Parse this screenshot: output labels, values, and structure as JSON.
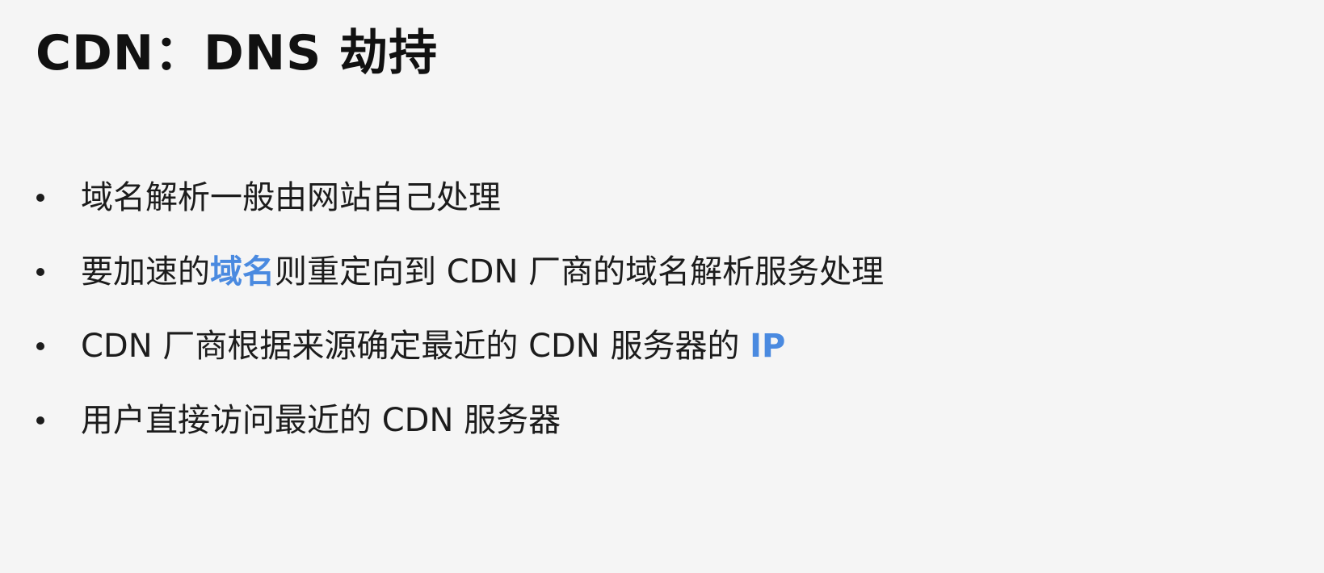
{
  "slide": {
    "title": "CDN：DNS 劫持",
    "bullets": [
      {
        "segments": [
          {
            "text": "域名解析一般由网站自己处理",
            "highlight": false
          }
        ]
      },
      {
        "segments": [
          {
            "text": "要加速的",
            "highlight": false
          },
          {
            "text": "域名",
            "highlight": true
          },
          {
            "text": "则重定向到 CDN 厂商的域名解析服务处理",
            "highlight": false
          }
        ]
      },
      {
        "segments": [
          {
            "text": "CDN 厂商根据来源确定最近的 CDN 服务器的 ",
            "highlight": false
          },
          {
            "text": "IP",
            "highlight": true
          }
        ]
      },
      {
        "segments": [
          {
            "text": "用户直接访问最近的 CDN 服务器",
            "highlight": false
          }
        ]
      }
    ]
  },
  "colors": {
    "background": "#f5f5f5",
    "text": "#1c1c1c",
    "highlight": "#4a8ae0"
  }
}
